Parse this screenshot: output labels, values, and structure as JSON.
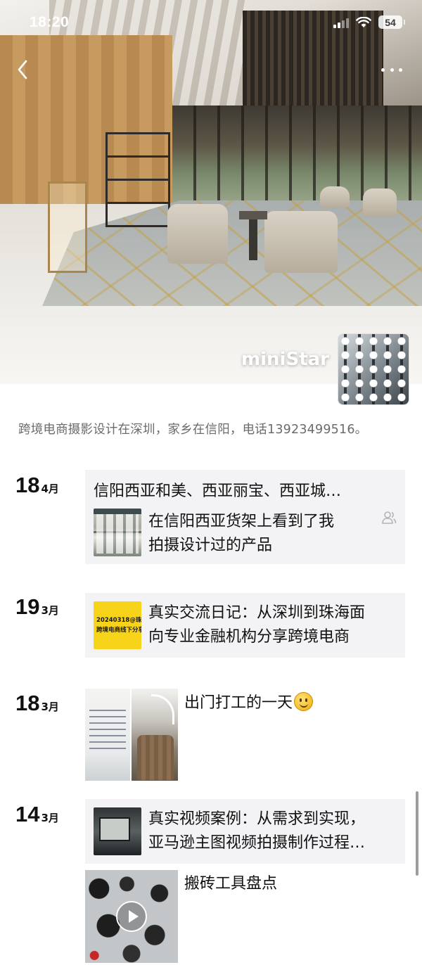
{
  "status_bar": {
    "time": "18:20",
    "battery": "54",
    "icons": [
      "signal-icon",
      "wifi-icon",
      "battery-icon"
    ]
  },
  "nav": {
    "back_icon": "chevron-left-icon",
    "more_icon": "more-dots-icon"
  },
  "profile": {
    "name": "miniStar",
    "bio": "跨境电商摄影设计在深圳，家乡在信阳，电话13923499516。"
  },
  "feed": [
    {
      "day": "18",
      "month": "4月",
      "type": "shared-article",
      "title": "信阳西亚和美、西亚丽宝、西亚城…",
      "thumbnail": "store-shelf",
      "text_line1": "在信阳西亚货架上看到了我",
      "text_line2": "拍摄设计过的产品",
      "visibility_icon": "friends-icon"
    },
    {
      "day": "19",
      "month": "3月",
      "type": "article",
      "thumbnail_line1": "20240318@珠海",
      "thumbnail_line2": "跨境电商线下分享",
      "text_line1": "真实交流日记：从深圳到珠海面",
      "text_line2": "向专业金融机构分享跨境电商"
    },
    {
      "day": "18",
      "month": "3月",
      "type": "photos",
      "text": "出门打工的一天",
      "emoji": "smile-emoji",
      "photos": [
        "train-ticket",
        "train-interior"
      ]
    },
    {
      "day": "14",
      "month": "3月",
      "type": "article",
      "thumbnail": "studio",
      "text_line1": "真实视频案例：从需求到实现，",
      "text_line2": "亚马逊主图视频拍摄制作过程…"
    },
    {
      "type": "video",
      "text": "搬砖工具盘点",
      "thumbnail": "camera-gear",
      "play_icon": "play-icon"
    }
  ],
  "colors": {
    "background": "#ffffff",
    "card_background": "#f3f3f5",
    "bio_text": "#6b6b6b",
    "thumbnail_yellow": "#f7d31a"
  }
}
